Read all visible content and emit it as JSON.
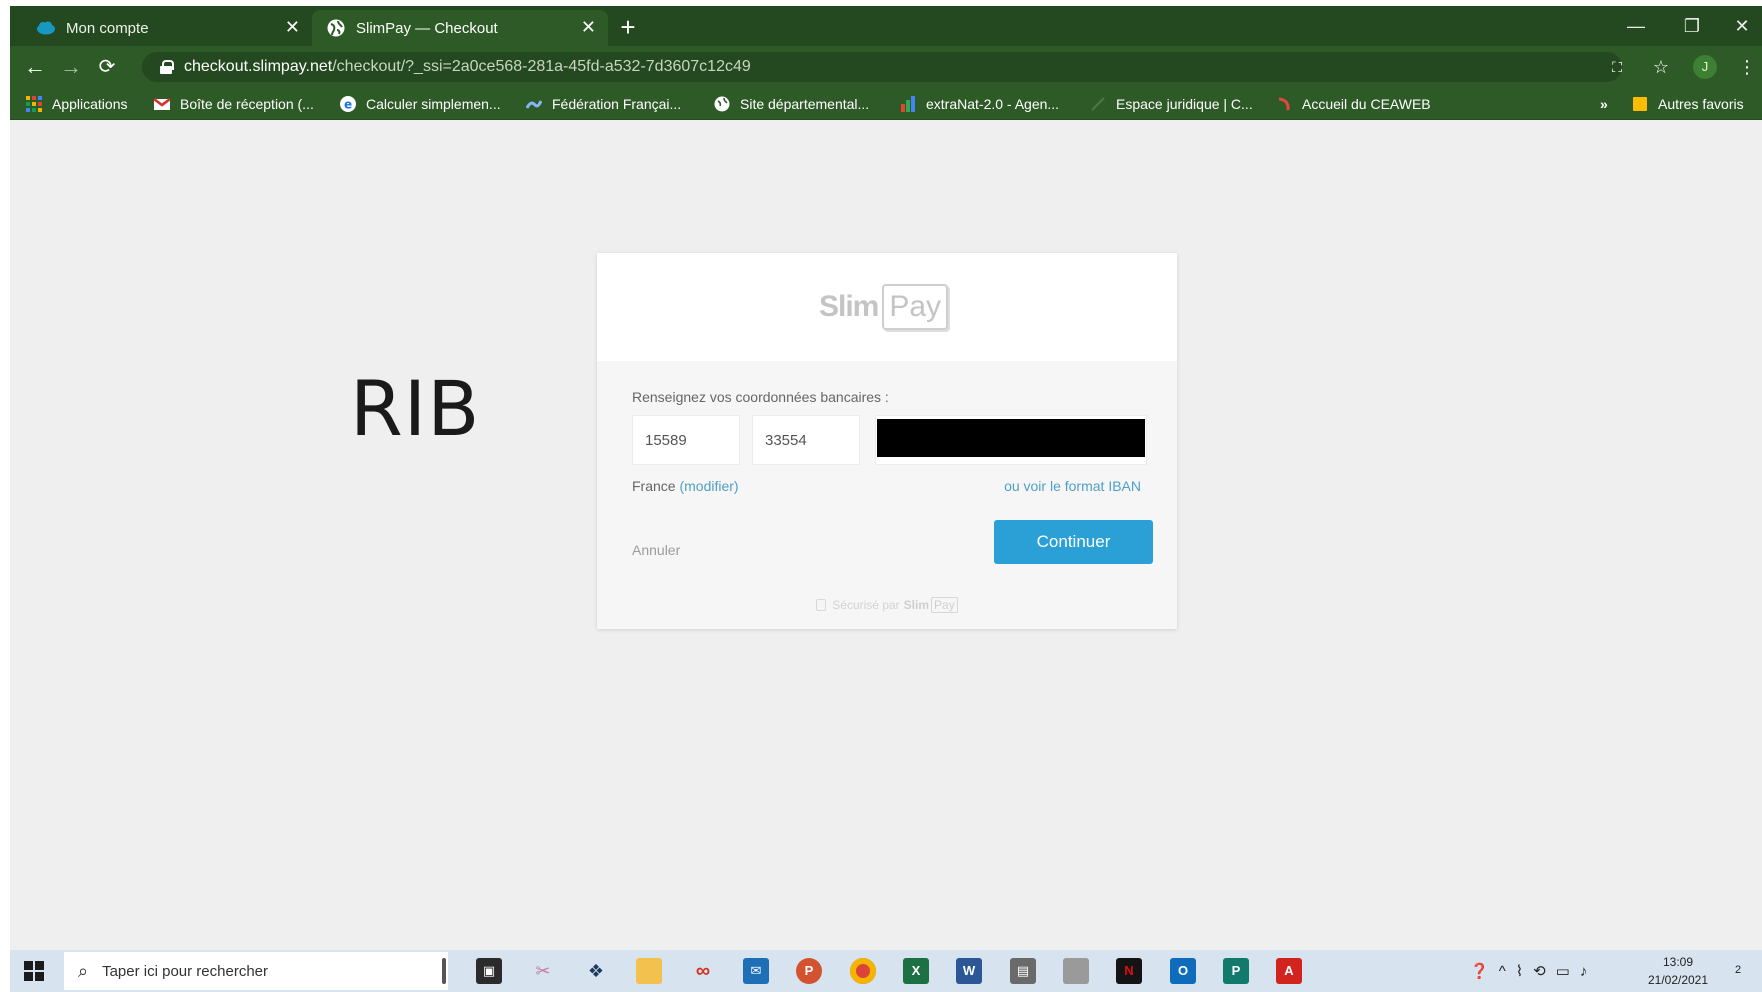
{
  "browser": {
    "tabs": [
      {
        "title": "Mon compte",
        "active": false,
        "icon": "salesforce-cloud-icon"
      },
      {
        "title": "SlimPay — Checkout",
        "active": true,
        "icon": "globe-icon"
      }
    ],
    "new_tab_label": "+",
    "url_host": "checkout.slimpay.net",
    "url_path": "/checkout/?_ssi=2a0ce568-281a-45fd-a532-7d3607c12c49",
    "avatar_initial": "J",
    "bookmarks": [
      {
        "label": "Applications",
        "icon": "apps-grid-icon"
      },
      {
        "label": "Boîte de réception (...",
        "icon": "gmail-icon"
      },
      {
        "label": "Calculer simplemen...",
        "icon": "e-icon"
      },
      {
        "label": "Fédération Françai...",
        "icon": "federation-icon"
      },
      {
        "label": "Site départemental...",
        "icon": "globe-icon"
      },
      {
        "label": "extraNat-2.0 - Agen...",
        "icon": "extranat-icon"
      },
      {
        "label": "Espace juridique | C...",
        "icon": "juridique-icon"
      },
      {
        "label": "Accueil du CEAWEB",
        "icon": "ceaweb-icon"
      }
    ],
    "bookmarks_overflow": "»",
    "other_bookmarks": "Autres favoris"
  },
  "page": {
    "annotation": "RIB",
    "logo_slim": "Slim",
    "logo_pay": "Pay",
    "instruction": "Renseignez vos coordonnées bancaires :",
    "bank_code": "15589",
    "branch_code": "33554",
    "country": "France",
    "modify_link": "(modifier)",
    "iban_link": "ou voir le format IBAN",
    "cancel_label": "Annuler",
    "continue_label": "Continuer",
    "secured_text": "Sécurisé par",
    "secured_slim": "Slim",
    "secured_pay": "Pay"
  },
  "taskbar": {
    "search_placeholder": "Taper ici pour rechercher",
    "time": "13:09",
    "date": "21/02/2021",
    "notification_count": "2"
  },
  "colors": {
    "chrome_dark": "#24481f",
    "chrome": "#2e5a27",
    "page_bg": "#efefef",
    "continue_blue": "#2aa0d6",
    "link_blue": "#4f9fc6"
  }
}
